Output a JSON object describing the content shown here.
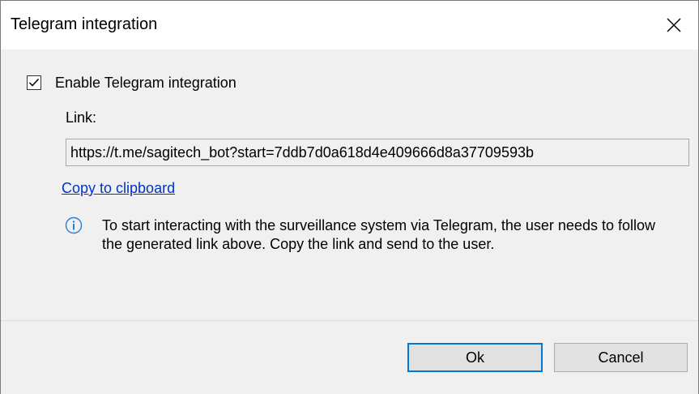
{
  "window": {
    "title": "Telegram integration",
    "close_symbol": "close-icon"
  },
  "enable": {
    "label": "Enable Telegram integration",
    "checked": true
  },
  "link": {
    "label": "Link:",
    "value": "https://t.me/sagitech_bot?start=7ddb7d0a618d4e409666d8a37709593b",
    "copy_label": "Copy to clipboard"
  },
  "info": {
    "icon": "info-icon",
    "text": "To start interacting with the surveillance system via Telegram, the user needs to follow the generated link above. Copy the link and send to the user."
  },
  "buttons": {
    "ok_label": "Ok",
    "cancel_label": "Cancel"
  },
  "colors": {
    "link": "#0033cc",
    "info_icon": "#2a7fd4",
    "default_button_border": "#0078d7"
  }
}
